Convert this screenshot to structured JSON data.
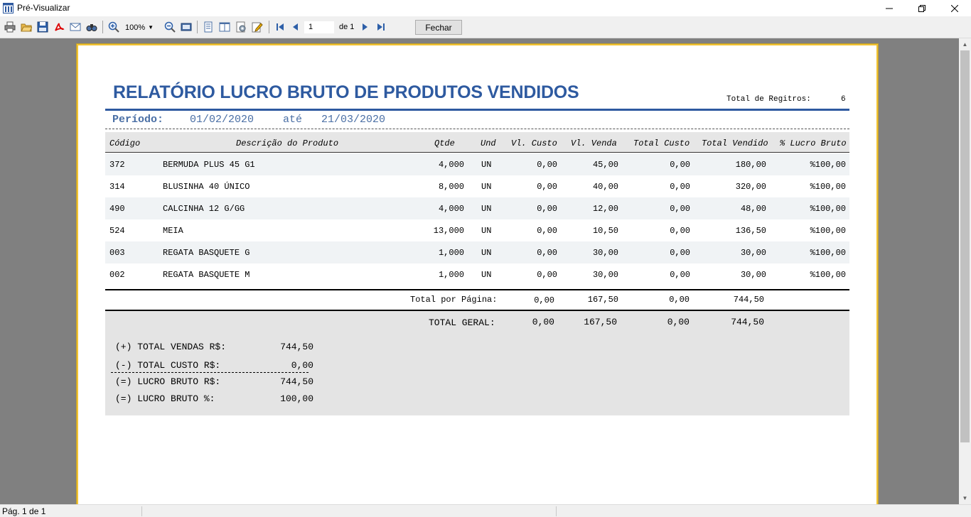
{
  "window": {
    "title": "Pré-Visualizar",
    "minimize_icon": "minimize-icon",
    "restore_icon": "restore-icon",
    "close_icon": "close-icon"
  },
  "toolbar": {
    "zoom": "100%",
    "page_number": "1",
    "page_of": "de 1",
    "close_label": "Fechar",
    "icons": [
      "print-icon",
      "open-folder-icon",
      "save-icon",
      "pdf-icon",
      "email-icon",
      "find-icon",
      "zoom-in-icon",
      "zoom-out-icon",
      "fit-page-icon",
      "single-page-icon",
      "two-pages-icon",
      "page-setup-icon",
      "edit-icon",
      "first-page-icon",
      "previous-page-icon",
      "next-page-icon",
      "last-page-icon"
    ]
  },
  "report": {
    "title": "RELATÓRIO LUCRO BRUTO DE PRODUTOS VENDIDOS",
    "records_label": "Total de Regitros:",
    "records_value": "6",
    "period_label": "Período:",
    "period_start": "01/02/2020",
    "period_sep": "até",
    "period_end": "21/03/2020",
    "columns": {
      "code": "Código",
      "description": "Descrição do Produto",
      "qty": "Qtde",
      "unit": "Und",
      "unit_cost": "Vl. Custo",
      "unit_price": "Vl. Venda",
      "total_cost": "Total Custo",
      "total_sold": "Total Vendido",
      "margin": "% Lucro Bruto"
    },
    "rows": [
      {
        "code": "372",
        "description": "BERMUDA PLUS 45 G1",
        "qty": "4,000",
        "unit": "UN",
        "unit_cost": "0,00",
        "unit_price": "45,00",
        "total_cost": "0,00",
        "total_sold": "180,00",
        "margin": "%100,00"
      },
      {
        "code": "314",
        "description": "BLUSINHA 40 ÚNICO",
        "qty": "8,000",
        "unit": "UN",
        "unit_cost": "0,00",
        "unit_price": "40,00",
        "total_cost": "0,00",
        "total_sold": "320,00",
        "margin": "%100,00"
      },
      {
        "code": "490",
        "description": "CALCINHA 12 G/GG",
        "qty": "4,000",
        "unit": "UN",
        "unit_cost": "0,00",
        "unit_price": "12,00",
        "total_cost": "0,00",
        "total_sold": "48,00",
        "margin": "%100,00"
      },
      {
        "code": "524",
        "description": "MEIA",
        "qty": "13,000",
        "unit": "UN",
        "unit_cost": "0,00",
        "unit_price": "10,50",
        "total_cost": "0,00",
        "total_sold": "136,50",
        "margin": "%100,00"
      },
      {
        "code": "003",
        "description": "REGATA BASQUETE G",
        "qty": "1,000",
        "unit": "UN",
        "unit_cost": "0,00",
        "unit_price": "30,00",
        "total_cost": "0,00",
        "total_sold": "30,00",
        "margin": "%100,00"
      },
      {
        "code": "002",
        "description": "REGATA BASQUETE M",
        "qty": "1,000",
        "unit": "UN",
        "unit_cost": "0,00",
        "unit_price": "30,00",
        "total_cost": "0,00",
        "total_sold": "30,00",
        "margin": "%100,00"
      }
    ],
    "page_total": {
      "label": "Total por Página:",
      "unit_cost": "0,00",
      "unit_price": "167,50",
      "total_cost": "0,00",
      "total_sold": "744,50"
    },
    "grand_total": {
      "label": "TOTAL GERAL:",
      "unit_cost": "0,00",
      "unit_price": "167,50",
      "total_cost": "0,00",
      "total_sold": "744,50"
    },
    "summary": [
      {
        "label": "(+) TOTAL VENDAS R$:",
        "value": "744,50"
      },
      {
        "label": "(-) TOTAL CUSTO R$:",
        "value": "0,00"
      },
      {
        "label": "(=)  LUCRO BRUTO R$:",
        "value": "744,50"
      },
      {
        "label": "(=)  LUCRO BRUTO %:",
        "value": "100,00"
      }
    ]
  },
  "status": {
    "page_info": "Pág. 1 de 1"
  }
}
